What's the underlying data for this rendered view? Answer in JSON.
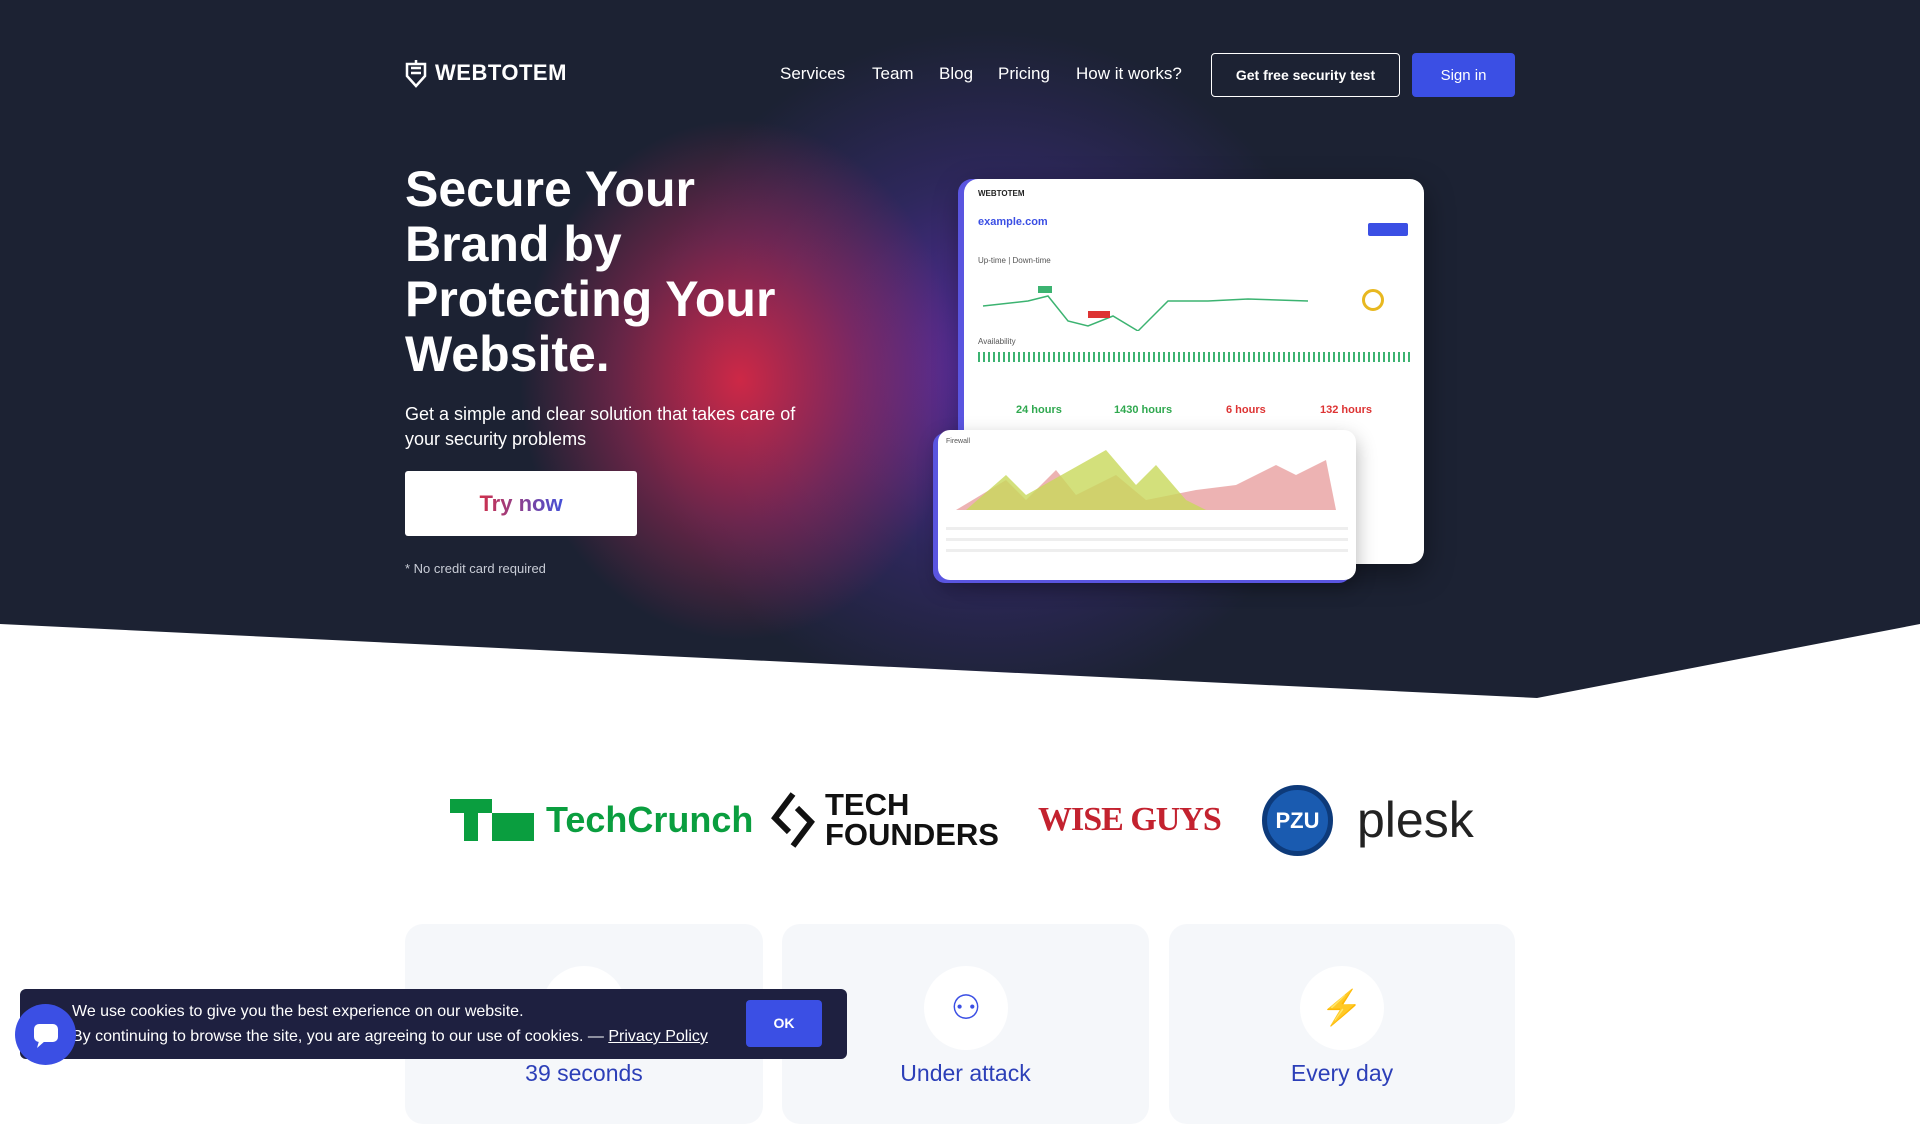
{
  "header": {
    "logo": "WEBTOTEM",
    "nav": [
      "Services",
      "Team",
      "Blog",
      "Pricing",
      "How it works?"
    ],
    "cta_outline": "Get free security test",
    "sign_in": "Sign in"
  },
  "hero": {
    "title": "Secure Your Brand by Protecting Your Website.",
    "subtitle": "Get a simple and clear solution that takes care of your security problems",
    "cta": "Try now",
    "note": "* No credit card required"
  },
  "dashboard": {
    "logo": "WEBTOTEM",
    "domain": "example.com",
    "uptime_label": "Up-time | Down-time",
    "availability_label": "Availability",
    "stats": [
      "24 hours",
      "1430 hours",
      "6 hours",
      "132 hours"
    ],
    "firewall_label": "Firewall"
  },
  "partners": [
    "TechCrunch",
    "TECH FOUNDERS",
    "WISE GUYS",
    "PZU",
    "plesk"
  ],
  "features": [
    {
      "title": "39 seconds",
      "icon": "timer-icon"
    },
    {
      "title": "Under attack",
      "icon": "heads-signal-icon"
    },
    {
      "title": "Every day",
      "icon": "lightning-icon"
    }
  ],
  "cookie": {
    "line1": "We use cookies to give you the best experience on our website.",
    "line2": "By continuing to browse the site, you are agreeing to our use of cookies. — ",
    "link": "Privacy Policy",
    "ok": "OK"
  },
  "colors": {
    "primary": "#3b4fe4",
    "hero_bg": "#1c2233",
    "techcrunch": "#0a9e3f",
    "wiseguys": "#c3222f"
  }
}
